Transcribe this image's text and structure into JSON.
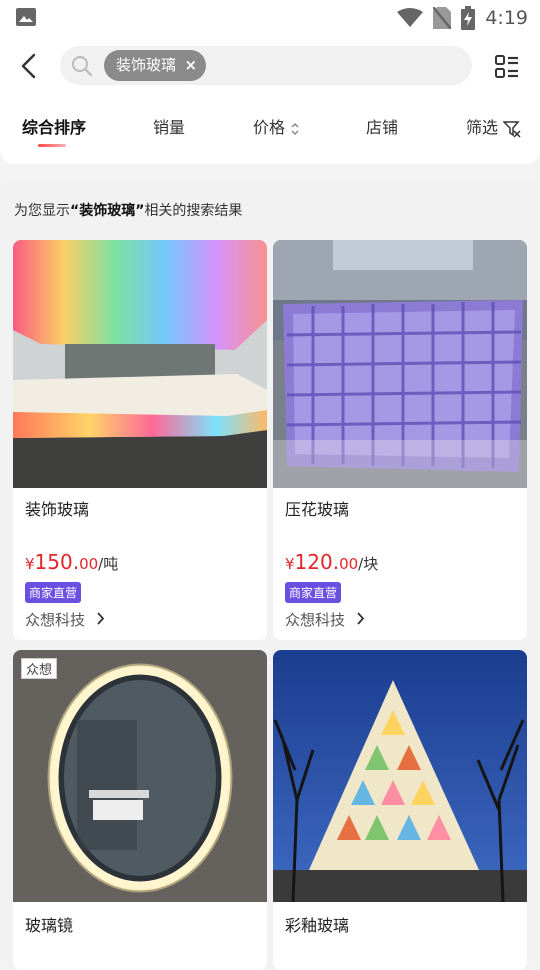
{
  "statusbar": {
    "time": "4:19",
    "icons": [
      "image-icon",
      "wifi-icon",
      "no-sim-icon",
      "battery-charging-icon"
    ]
  },
  "header": {
    "search_chip": "装饰玻璃",
    "chip_close": "×",
    "sort_tabs": [
      {
        "label": "综合排序",
        "active": true
      },
      {
        "label": "销量"
      },
      {
        "label": "价格"
      },
      {
        "label": "店铺"
      },
      {
        "label": "筛选"
      }
    ]
  },
  "results": {
    "hint_prefix": "为您显示",
    "hint_keyword": "“装饰玻璃”",
    "hint_suffix": "相关的搜索结果",
    "products": [
      {
        "title": "装饰玻璃",
        "price_symbol": "¥",
        "price_int": "150.",
        "price_dec": "00",
        "unit": "/吨",
        "badge": "商家直营",
        "shop": "众想科技"
      },
      {
        "title": "压花玻璃",
        "price_symbol": "¥",
        "price_int": "120.",
        "price_dec": "00",
        "unit": "/块",
        "badge": "商家直营",
        "shop": "众想科技"
      },
      {
        "title": "玻璃镜",
        "watermark": "众想"
      },
      {
        "title": "彩釉玻璃"
      }
    ]
  },
  "colors": {
    "price": "#e4262a",
    "badge": "#6b4fe0",
    "chip": "#8a8a8a"
  }
}
